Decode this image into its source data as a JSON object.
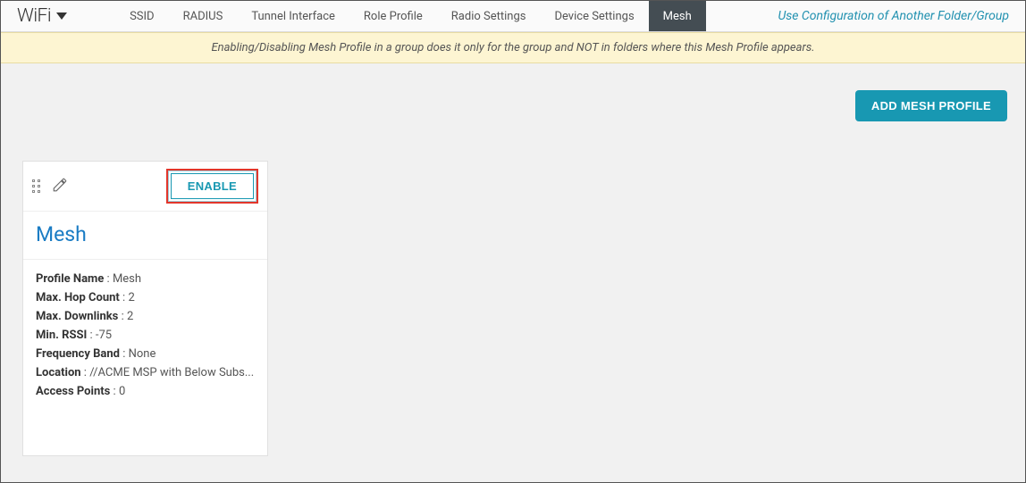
{
  "brand": {
    "label": "WiFi"
  },
  "tabs": [
    {
      "label": "SSID",
      "active": false
    },
    {
      "label": "RADIUS",
      "active": false
    },
    {
      "label": "Tunnel Interface",
      "active": false
    },
    {
      "label": "Role Profile",
      "active": false
    },
    {
      "label": "Radio Settings",
      "active": false
    },
    {
      "label": "Device Settings",
      "active": false
    },
    {
      "label": "Mesh",
      "active": true
    }
  ],
  "config_link": "Use Configuration of Another Folder/Group",
  "banner": "Enabling/Disabling Mesh Profile in a group does it only for the group and NOT in folders where this Mesh Profile appears.",
  "add_button": "ADD MESH PROFILE",
  "card": {
    "enable_label": "ENABLE",
    "title": "Mesh",
    "props": [
      {
        "k": "Profile Name",
        "v": "Mesh"
      },
      {
        "k": "Max. Hop Count",
        "v": "2"
      },
      {
        "k": "Max. Downlinks",
        "v": "2"
      },
      {
        "k": "Min. RSSI",
        "v": "-75"
      },
      {
        "k": "Frequency Band",
        "v": "None"
      },
      {
        "k": "Location",
        "v": "//ACME MSP with Below Subs..."
      },
      {
        "k": "Access Points",
        "v": "0"
      }
    ]
  }
}
